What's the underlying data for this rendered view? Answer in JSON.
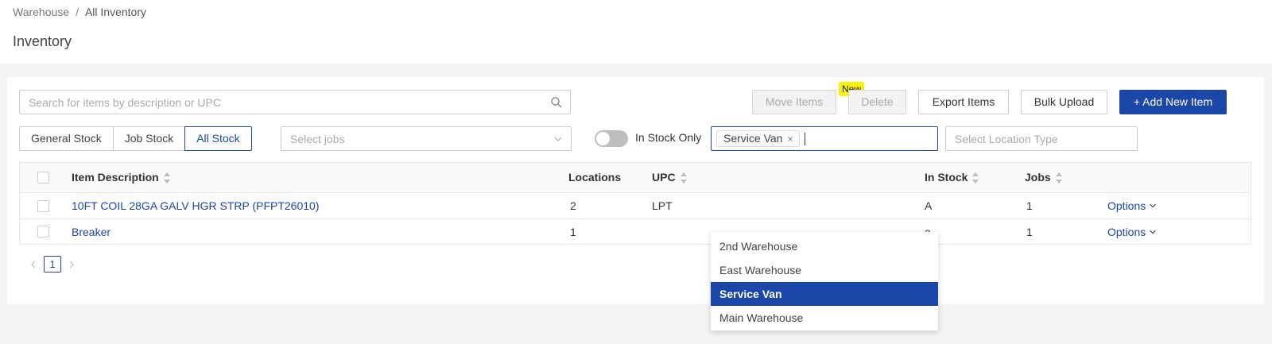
{
  "breadcrumb": {
    "root": "Warehouse",
    "separator": "/",
    "current": "All Inventory"
  },
  "page_title": "Inventory",
  "search": {
    "placeholder": "Search for items by description or UPC",
    "icon": "search-icon"
  },
  "toolbar": {
    "move_items": "Move Items",
    "new_badge": "New",
    "delete": "Delete",
    "export_items": "Export Items",
    "bulk_upload": "Bulk Upload",
    "add_new_item": "+ Add New Item"
  },
  "stock_tabs": [
    "General Stock",
    "Job Stock",
    "All Stock"
  ],
  "active_stock_tab": "All Stock",
  "jobs_select": {
    "placeholder": "Select jobs"
  },
  "in_stock_toggle": {
    "label": "In Stock Only",
    "on": false
  },
  "location_select": {
    "selected_tag": "Service Van",
    "remove_glyph": "×",
    "options": [
      "2nd Warehouse",
      "East Warehouse",
      "Service Van",
      "Main Warehouse"
    ],
    "highlighted": "Service Van"
  },
  "location_type_select": {
    "placeholder": "Select Location Type"
  },
  "table": {
    "columns": [
      "Item Description",
      "Locations",
      "UPC",
      "In Stock",
      "Jobs"
    ],
    "rows": [
      {
        "description": "10FT COIL 28GA GALV HGR STRP (PFPT26010)",
        "locations": "2",
        "upc": "LPT",
        "in_stock": "A",
        "jobs": "1",
        "options": "Options"
      },
      {
        "description": "Breaker",
        "locations": "1",
        "upc": "",
        "in_stock": "a",
        "jobs": "1",
        "options": "Options"
      }
    ]
  },
  "pagination": {
    "current_page": "1"
  },
  "colors": {
    "primary": "#1a47a8",
    "badge": "#f7f10e",
    "background": "#f4f4f4"
  }
}
